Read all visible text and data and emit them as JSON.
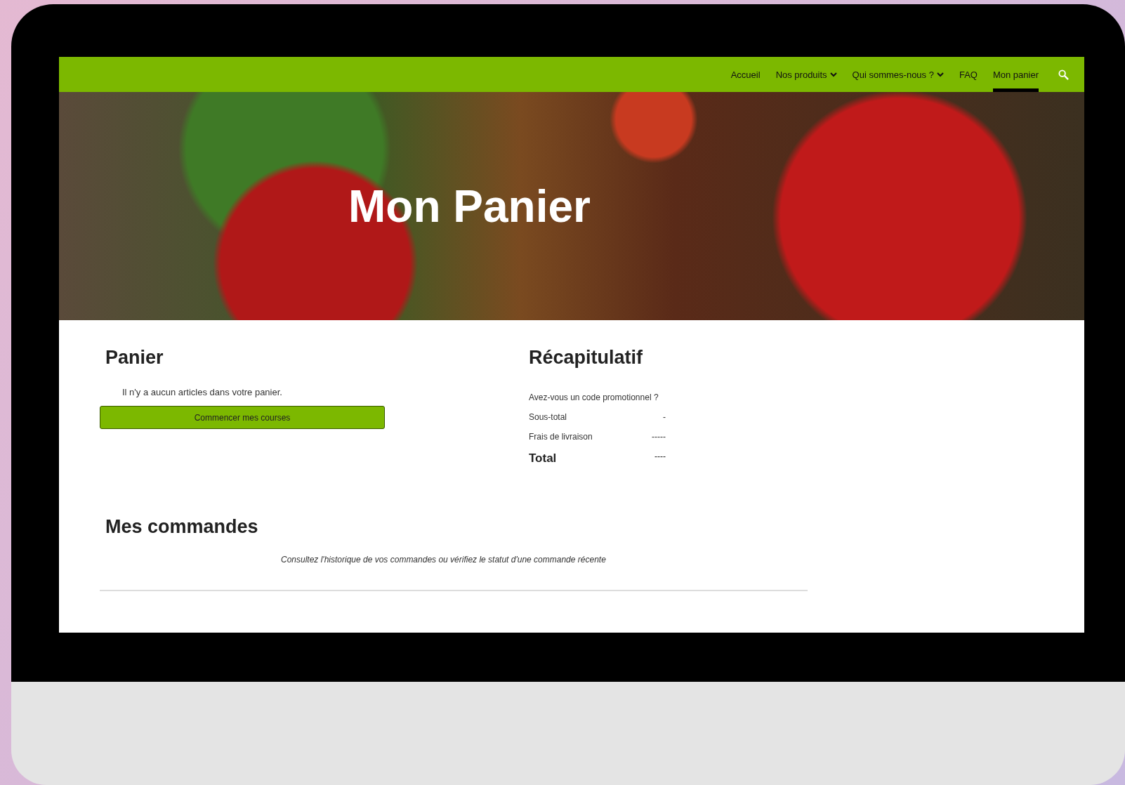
{
  "nav": {
    "items": [
      {
        "label": "Accueil",
        "has_menu": false,
        "selected": false
      },
      {
        "label": "Nos produits",
        "has_menu": true,
        "selected": false
      },
      {
        "label": "Qui sommes-nous ?",
        "has_menu": true,
        "selected": false
      },
      {
        "label": "FAQ",
        "has_menu": false,
        "selected": false
      },
      {
        "label": "Mon panier",
        "has_menu": false,
        "selected": true
      }
    ]
  },
  "hero": {
    "title": "Mon Panier"
  },
  "cart": {
    "heading": "Panier",
    "message": "Il n'y a aucun articles dans votre panier.",
    "button": "Commencer mes courses"
  },
  "summary": {
    "heading": "Récapitulatif",
    "promo_link": "Avez-vous un code promotionnel ?",
    "rows": [
      {
        "label": "Sous-total",
        "value": "-",
        "kind": "normal"
      },
      {
        "label": "Frais de livraison",
        "value": "-----",
        "kind": "normal"
      },
      {
        "label": "Total",
        "value": "----",
        "kind": "total"
      }
    ]
  },
  "orders": {
    "heading": "Mes commandes",
    "description": "Consultez l'historique de vos commandes ou vérifiez le statut d'une commande récente"
  }
}
